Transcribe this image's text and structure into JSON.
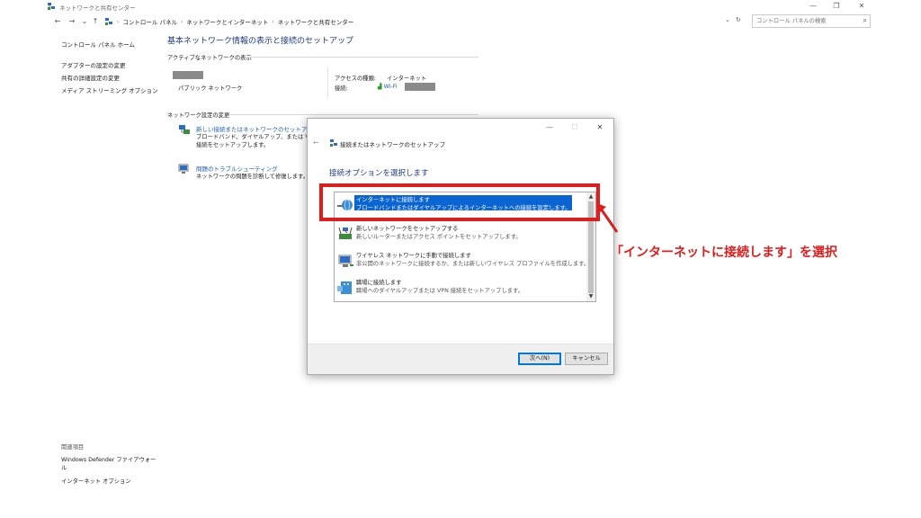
{
  "window": {
    "title": "ネットワークと共有センター",
    "minimize": "—",
    "restore": "❐",
    "close": "✕"
  },
  "nav": {
    "back": "←",
    "forward": "→",
    "recent": "⌄",
    "up": "↑",
    "breadcrumb": [
      "コントロール パネル",
      "ネットワークとインターネット",
      "ネットワークと共有センター"
    ],
    "separator": "›",
    "dropdown": "⌄",
    "refresh": "↻",
    "search_placeholder": "コントロール パネルの検索",
    "search_icon": "⌕"
  },
  "sidebar": {
    "home": "コントロール パネル ホーム",
    "links": [
      "アダプターの設定の変更",
      "共有の詳細設定の変更",
      "メディア ストリーミング オプション"
    ],
    "related_title": "関連項目",
    "related_links": [
      "Windows Defender ファイアウォール",
      "インターネット オプション"
    ]
  },
  "main": {
    "title": "基本ネットワーク情報の表示と接続のセットアップ",
    "active_label": "アクティブなネットワークの表示",
    "network_type": "パブリック ネットワーク",
    "access_type_label": "アクセスの種類:",
    "access_type_value": "インターネット",
    "connection_label": "接続:",
    "connection_value": "Wi-Fi",
    "change_label": "ネットワーク設定の変更",
    "settings": [
      {
        "link": "新しい接続またはネットワークのセットアップ",
        "desc": "ブロードバンド、ダイヤルアップ、または VPN 接続をセットアップします。"
      },
      {
        "link": "問題のトラブルシューティング",
        "desc": "ネットワークの問題を診断して修復します。ま"
      }
    ]
  },
  "dialog": {
    "back": "←",
    "title": "接続またはネットワークのセットアップ",
    "minimize": "—",
    "maximize": "☐",
    "close": "✕",
    "heading": "接続オプションを選択します",
    "options": [
      {
        "title": "インターネットに接続します",
        "desc": "ブロードバンドまたはダイヤルアップによるインターネットへの接続を設定します。",
        "selected": true
      },
      {
        "title": "新しいネットワークをセットアップする",
        "desc": "新しいルーターまたはアクセス ポイントをセットアップします。",
        "selected": false
      },
      {
        "title": "ワイヤレス ネットワークに手動で接続します",
        "desc": "非公開のネットワークに接続するか、または新しいワイヤレス プロファイルを作成します。",
        "selected": false
      },
      {
        "title": "職場に接続します",
        "desc": "職場へのダイヤルアップまたは VPN 接続をセットアップします。",
        "selected": false
      }
    ],
    "scroll_up": "▲",
    "scroll_down": "▼",
    "next_button": "次へ(N)",
    "cancel_button": "キャンセル"
  },
  "annotation": {
    "text": "「インターネットに接続します」を選択",
    "color": "#e01d1d"
  },
  "colors": {
    "accent": "#1e3b8a",
    "link": "#1e5fb3",
    "selection": "#0a64d2",
    "annotation_red": "#e01d1d"
  }
}
